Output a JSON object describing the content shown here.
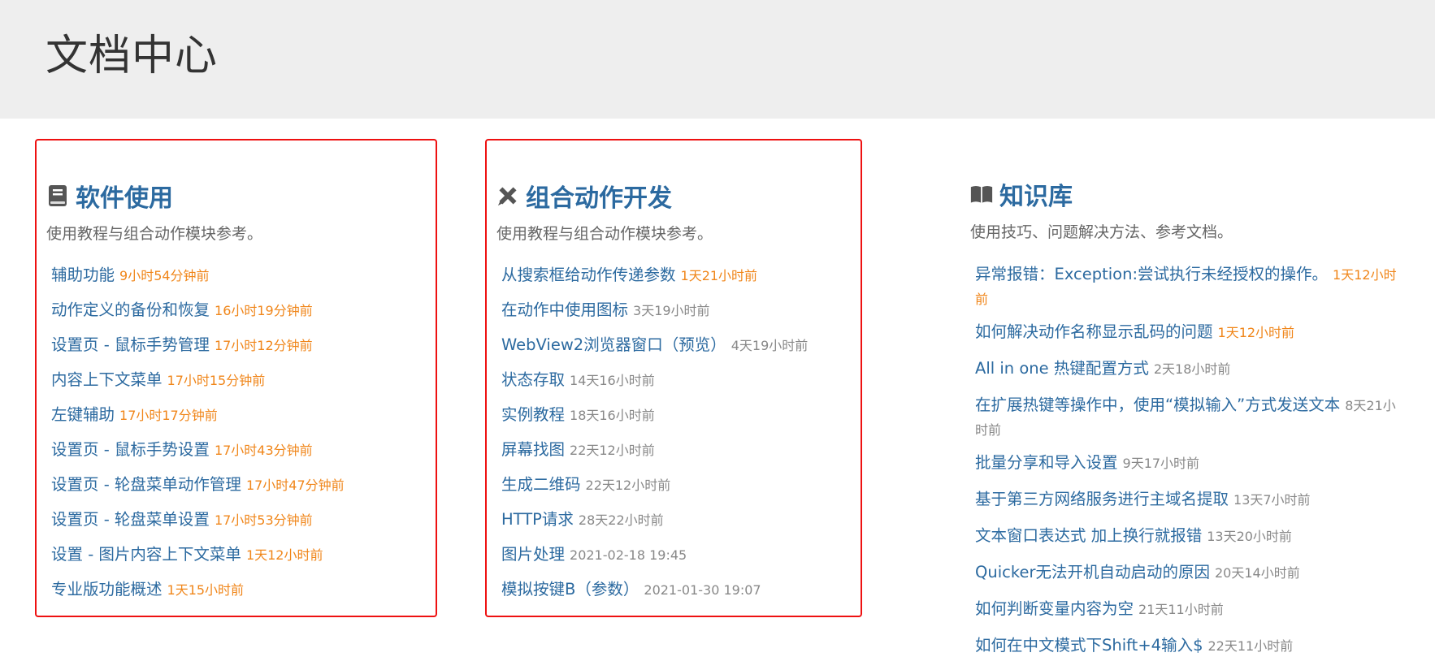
{
  "page": {
    "title": "文档中心"
  },
  "sections": [
    {
      "title": "软件使用",
      "icon": "book-icon",
      "description": "使用教程与组合动作模块参考。",
      "items": [
        {
          "label": "辅助功能",
          "time": "9小时54分钟前",
          "recent": true
        },
        {
          "label": "动作定义的备份和恢复",
          "time": "16小时19分钟前",
          "recent": true
        },
        {
          "label": "设置页 - 鼠标手势管理",
          "time": "17小时12分钟前",
          "recent": true
        },
        {
          "label": "内容上下文菜单",
          "time": "17小时15分钟前",
          "recent": true
        },
        {
          "label": "左键辅助",
          "time": "17小时17分钟前",
          "recent": true
        },
        {
          "label": "设置页 - 鼠标手势设置",
          "time": "17小时43分钟前",
          "recent": true
        },
        {
          "label": "设置页 - 轮盘菜单动作管理",
          "time": "17小时47分钟前",
          "recent": true
        },
        {
          "label": "设置页 - 轮盘菜单设置",
          "time": "17小时53分钟前",
          "recent": true
        },
        {
          "label": "设置 - 图片内容上下文菜单",
          "time": "1天12小时前",
          "recent": true
        },
        {
          "label": "专业版功能概述",
          "time": "1天15小时前",
          "recent": true
        }
      ]
    },
    {
      "title": "组合动作开发",
      "icon": "pencil-ruler-icon",
      "description": "使用教程与组合动作模块参考。",
      "items": [
        {
          "label": "从搜索框给动作传递参数",
          "time": "1天21小时前",
          "recent": true
        },
        {
          "label": "在动作中使用图标",
          "time": "3天19小时前",
          "recent": false
        },
        {
          "label": "WebView2浏览器窗口（预览）",
          "time": "4天19小时前",
          "recent": false
        },
        {
          "label": "状态存取",
          "time": "14天16小时前",
          "recent": false
        },
        {
          "label": "实例教程",
          "time": "18天16小时前",
          "recent": false
        },
        {
          "label": "屏幕找图",
          "time": "22天12小时前",
          "recent": false
        },
        {
          "label": "生成二维码",
          "time": "22天12小时前",
          "recent": false
        },
        {
          "label": "HTTP请求",
          "time": "28天22小时前",
          "recent": false
        },
        {
          "label": "图片处理",
          "time": "2021-02-18 19:45",
          "recent": false
        },
        {
          "label": "模拟按键B（参数）",
          "time": "2021-01-30 19:07",
          "recent": false
        }
      ]
    },
    {
      "title": "知识库",
      "icon": "open-book-icon",
      "description": "使用技巧、问题解决方法、参考文档。",
      "items": [
        {
          "label": "异常报错：Exception:尝试执行未经授权的操作。",
          "time": "1天12小时前",
          "recent": true
        },
        {
          "label": "如何解决动作名称显示乱码的问题",
          "time": "1天12小时前",
          "recent": true
        },
        {
          "label": "All in one 热键配置方式",
          "time": "2天18小时前",
          "recent": false
        },
        {
          "label": "在扩展热键等操作中，使用“模拟输入”方式发送文本",
          "time": "8天21小时前",
          "recent": false
        },
        {
          "label": "批量分享和导入设置",
          "time": "9天17小时前",
          "recent": false
        },
        {
          "label": "基于第三方网络服务进行主域名提取",
          "time": "13天7小时前",
          "recent": false
        },
        {
          "label": "文本窗口表达式 加上换行就报错",
          "time": "13天20小时前",
          "recent": false
        },
        {
          "label": "Quicker无法开机自动启动的原因",
          "time": "20天14小时前",
          "recent": false
        },
        {
          "label": "如何判断变量内容为空",
          "time": "21天11小时前",
          "recent": false
        },
        {
          "label": "如何在中文模式下Shift+4输入$",
          "time": "22天11小时前",
          "recent": false
        }
      ]
    }
  ],
  "colors": {
    "link": "#2c6aa0",
    "recent_time": "#f0861a",
    "old_time": "#888888",
    "highlight_border": "#ee1111",
    "header_bg": "#eeeeee"
  }
}
